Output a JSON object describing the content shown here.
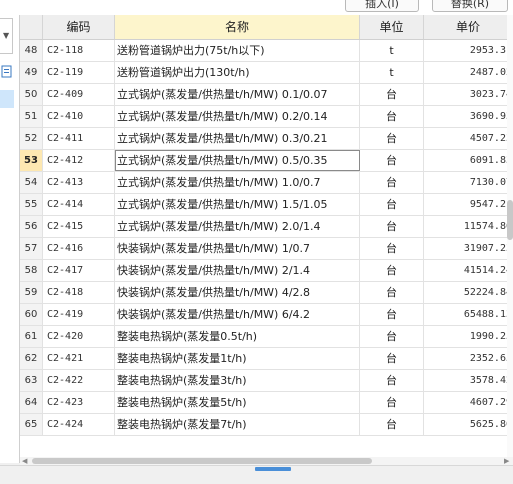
{
  "toolbar": {
    "insert_label": "插入(I)",
    "replace_label": "替换(R)"
  },
  "headers": {
    "code": "编码",
    "name": "名称",
    "unit": "单位",
    "price": "单价"
  },
  "active_row_index": "53",
  "rows": [
    {
      "idx": "48",
      "code": "C2-118",
      "name": "送粉管道锅炉出力(75t/h以下)",
      "unit": "t",
      "price": "2953.31"
    },
    {
      "idx": "49",
      "code": "C2-119",
      "name": "送粉管道锅炉出力(130t/h)",
      "unit": "t",
      "price": "2487.02"
    },
    {
      "idx": "50",
      "code": "C2-409",
      "name": "立式锅炉(蒸发量/供热量t/h/MW) 0.1/0.07",
      "unit": "台",
      "price": "3023.74"
    },
    {
      "idx": "51",
      "code": "C2-410",
      "name": "立式锅炉(蒸发量/供热量t/h/MW) 0.2/0.14",
      "unit": "台",
      "price": "3690.93"
    },
    {
      "idx": "52",
      "code": "C2-411",
      "name": "立式锅炉(蒸发量/供热量t/h/MW) 0.3/0.21",
      "unit": "台",
      "price": "4507.23"
    },
    {
      "idx": "53",
      "code": "C2-412",
      "name": "立式锅炉(蒸发量/供热量t/h/MW) 0.5/0.35",
      "unit": "台",
      "price": "6091.83"
    },
    {
      "idx": "54",
      "code": "C2-413",
      "name": "立式锅炉(蒸发量/供热量t/h/MW) 1.0/0.7",
      "unit": "台",
      "price": "7130.07"
    },
    {
      "idx": "55",
      "code": "C2-414",
      "name": "立式锅炉(蒸发量/供热量t/h/MW) 1.5/1.05",
      "unit": "台",
      "price": "9547.21"
    },
    {
      "idx": "56",
      "code": "C2-415",
      "name": "立式锅炉(蒸发量/供热量t/h/MW) 2.0/1.4",
      "unit": "台",
      "price": "11574.86"
    },
    {
      "idx": "57",
      "code": "C2-416",
      "name": "快装锅炉(蒸发量/供热量t/h/MW) 1/0.7",
      "unit": "台",
      "price": "31907.23"
    },
    {
      "idx": "58",
      "code": "C2-417",
      "name": "快装锅炉(蒸发量/供热量t/h/MW) 2/1.4",
      "unit": "台",
      "price": "41514.24"
    },
    {
      "idx": "59",
      "code": "C2-418",
      "name": "快装锅炉(蒸发量/供热量t/h/MW) 4/2.8",
      "unit": "台",
      "price": "52224.84"
    },
    {
      "idx": "60",
      "code": "C2-419",
      "name": "快装锅炉(蒸发量/供热量t/h/MW) 6/4.2",
      "unit": "台",
      "price": "65488.13"
    },
    {
      "idx": "61",
      "code": "C2-420",
      "name": "整装电热锅炉(蒸发量0.5t/h)",
      "unit": "台",
      "price": "1990.25"
    },
    {
      "idx": "62",
      "code": "C2-421",
      "name": "整装电热锅炉(蒸发量1t/h)",
      "unit": "台",
      "price": "2352.65"
    },
    {
      "idx": "63",
      "code": "C2-422",
      "name": "整装电热锅炉(蒸发量3t/h)",
      "unit": "台",
      "price": "3578.42"
    },
    {
      "idx": "64",
      "code": "C2-423",
      "name": "整装电热锅炉(蒸发量5t/h)",
      "unit": "台",
      "price": "4607.29"
    },
    {
      "idx": "65",
      "code": "C2-424",
      "name": "整装电热锅炉(蒸发量7t/h)",
      "unit": "台",
      "price": "5625.86"
    }
  ]
}
